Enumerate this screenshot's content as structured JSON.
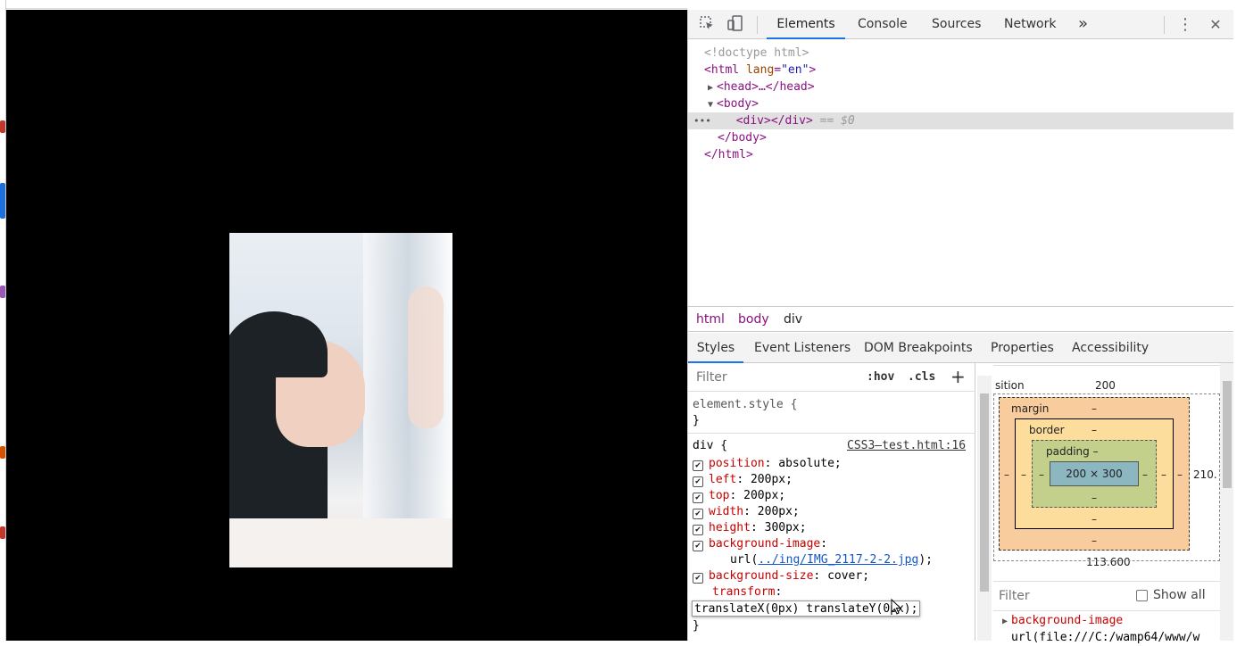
{
  "devtools": {
    "tabs": [
      "Elements",
      "Console",
      "Sources",
      "Network"
    ],
    "more_tabs": "»",
    "close": "✕",
    "menu": "⋮"
  },
  "dom": {
    "doctype": "<!doctype html>",
    "html_open_tag": "<html",
    "html_attr": "lang",
    "html_attr_val": "\"en\"",
    "head": "<head>…</head>",
    "body_open": "<body>",
    "div_line": "<div></div>",
    "selected_marker": "== $0",
    "body_close": "</body>",
    "html_close": "</html>",
    "ellipsis": "•••"
  },
  "breadcrumbs": [
    "html",
    "body",
    "div"
  ],
  "subtabs": [
    "Styles",
    "Event Listeners",
    "DOM Breakpoints",
    "Properties",
    "Accessibility"
  ],
  "styles": {
    "filter_placeholder": "Filter",
    "hov": ":hov",
    "cls": ".cls",
    "plus": "+",
    "element_style": "element.style {",
    "close_brace": "}",
    "selector": "div {",
    "source": "CSS3—test.html:16",
    "rules": [
      {
        "prop": "position",
        "value": "absolute;"
      },
      {
        "prop": "left",
        "value": "200px;"
      },
      {
        "prop": "top",
        "value": "200px;"
      },
      {
        "prop": "width",
        "value": "200px;"
      },
      {
        "prop": "height",
        "value": "300px;"
      },
      {
        "prop": "background-image",
        "value": ""
      }
    ],
    "bg_url_prefix": "url(",
    "bg_url_link": "../ing/IMG_2117-2-2.jpg",
    "bg_url_suffix": ");",
    "bg_size_prop": "background-size",
    "bg_size_val": "cover;",
    "transform_prop": "transform",
    "transform_edit": "translateX(0px) translateY(0px);"
  },
  "boxmodel": {
    "position_label": "sition",
    "position_top": "200",
    "position_right": "210.",
    "position_bottom": "113.600",
    "margin": "margin",
    "border": "border",
    "padding": "padding",
    "dash": "–",
    "content": "200 × 300"
  },
  "computed": {
    "filter_placeholder": "Filter",
    "show_all": "Show all",
    "prop": "background-image",
    "value": "url(file:///C:/wamp64/www/w"
  }
}
